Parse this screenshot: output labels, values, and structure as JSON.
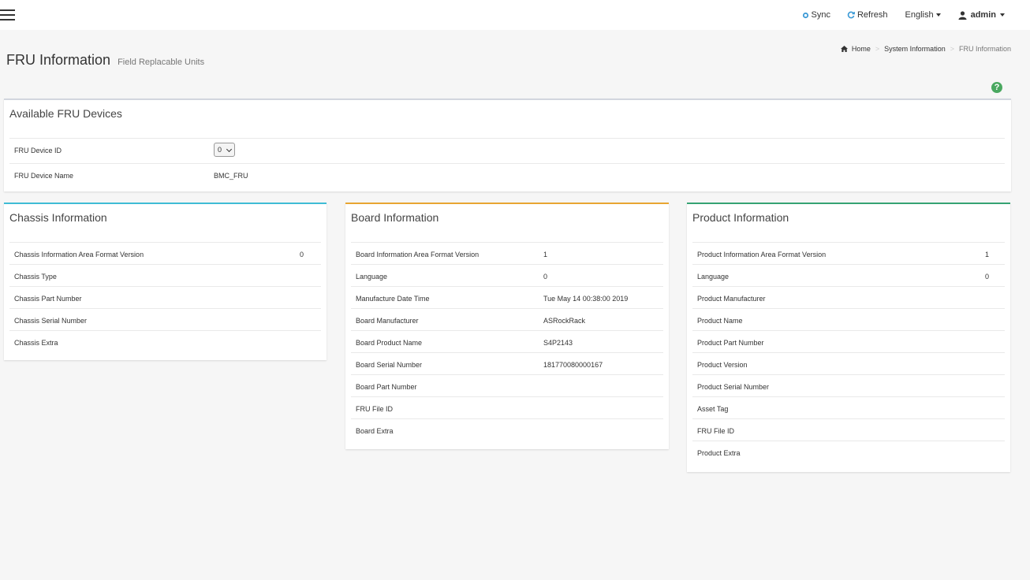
{
  "header": {
    "sync_label": "Sync",
    "refresh_label": "Refresh",
    "language": "English",
    "user": "admin"
  },
  "page": {
    "title": "FRU Information",
    "subtitle": "Field Replacable Units"
  },
  "breadcrumb": {
    "home": "Home",
    "section": "System Information",
    "current": "FRU Information"
  },
  "available": {
    "title": "Available FRU Devices",
    "device_id_label": "FRU Device ID",
    "device_id_value": "0",
    "device_name_label": "FRU Device Name",
    "device_name_value": "BMC_FRU"
  },
  "chassis": {
    "title": "Chassis Information",
    "rows": [
      {
        "label": "Chassis Information Area Format Version",
        "value": "0"
      },
      {
        "label": "Chassis Type",
        "value": ""
      },
      {
        "label": "Chassis Part Number",
        "value": ""
      },
      {
        "label": "Chassis Serial Number",
        "value": ""
      },
      {
        "label": "Chassis Extra",
        "value": ""
      }
    ]
  },
  "board": {
    "title": "Board Information",
    "rows": [
      {
        "label": "Board Information Area Format Version",
        "value": "1"
      },
      {
        "label": "Language",
        "value": "0"
      },
      {
        "label": "Manufacture Date Time",
        "value": "Tue May 14 00:38:00 2019"
      },
      {
        "label": "Board Manufacturer",
        "value": "ASRockRack"
      },
      {
        "label": "Board Product Name",
        "value": "S4P2143"
      },
      {
        "label": "Board Serial Number",
        "value": "181770080000167"
      },
      {
        "label": "Board Part Number",
        "value": ""
      },
      {
        "label": "FRU File ID",
        "value": ""
      },
      {
        "label": "Board Extra",
        "value": ""
      }
    ]
  },
  "product": {
    "title": "Product Information",
    "rows": [
      {
        "label": "Product Information Area Format Version",
        "value": "1"
      },
      {
        "label": "Language",
        "value": "0"
      },
      {
        "label": "Product Manufacturer",
        "value": ""
      },
      {
        "label": "Product Name",
        "value": ""
      },
      {
        "label": "Product Part Number",
        "value": ""
      },
      {
        "label": "Product Version",
        "value": ""
      },
      {
        "label": "Product Serial Number",
        "value": ""
      },
      {
        "label": "Asset Tag",
        "value": ""
      },
      {
        "label": "FRU File ID",
        "value": ""
      },
      {
        "label": "Product Extra",
        "value": ""
      }
    ]
  },
  "colors": {
    "chassis_accent": "#3fbcd5",
    "board_accent": "#e8a632",
    "product_accent": "#36a373",
    "help_icon": "#4aa860",
    "sync_icon": "#3c9ad6"
  },
  "icons": {
    "menu": "hamburger-icon",
    "sync": "sync-icon",
    "refresh": "refresh-icon",
    "user": "user-icon",
    "home": "home-icon",
    "help": "help-icon"
  }
}
